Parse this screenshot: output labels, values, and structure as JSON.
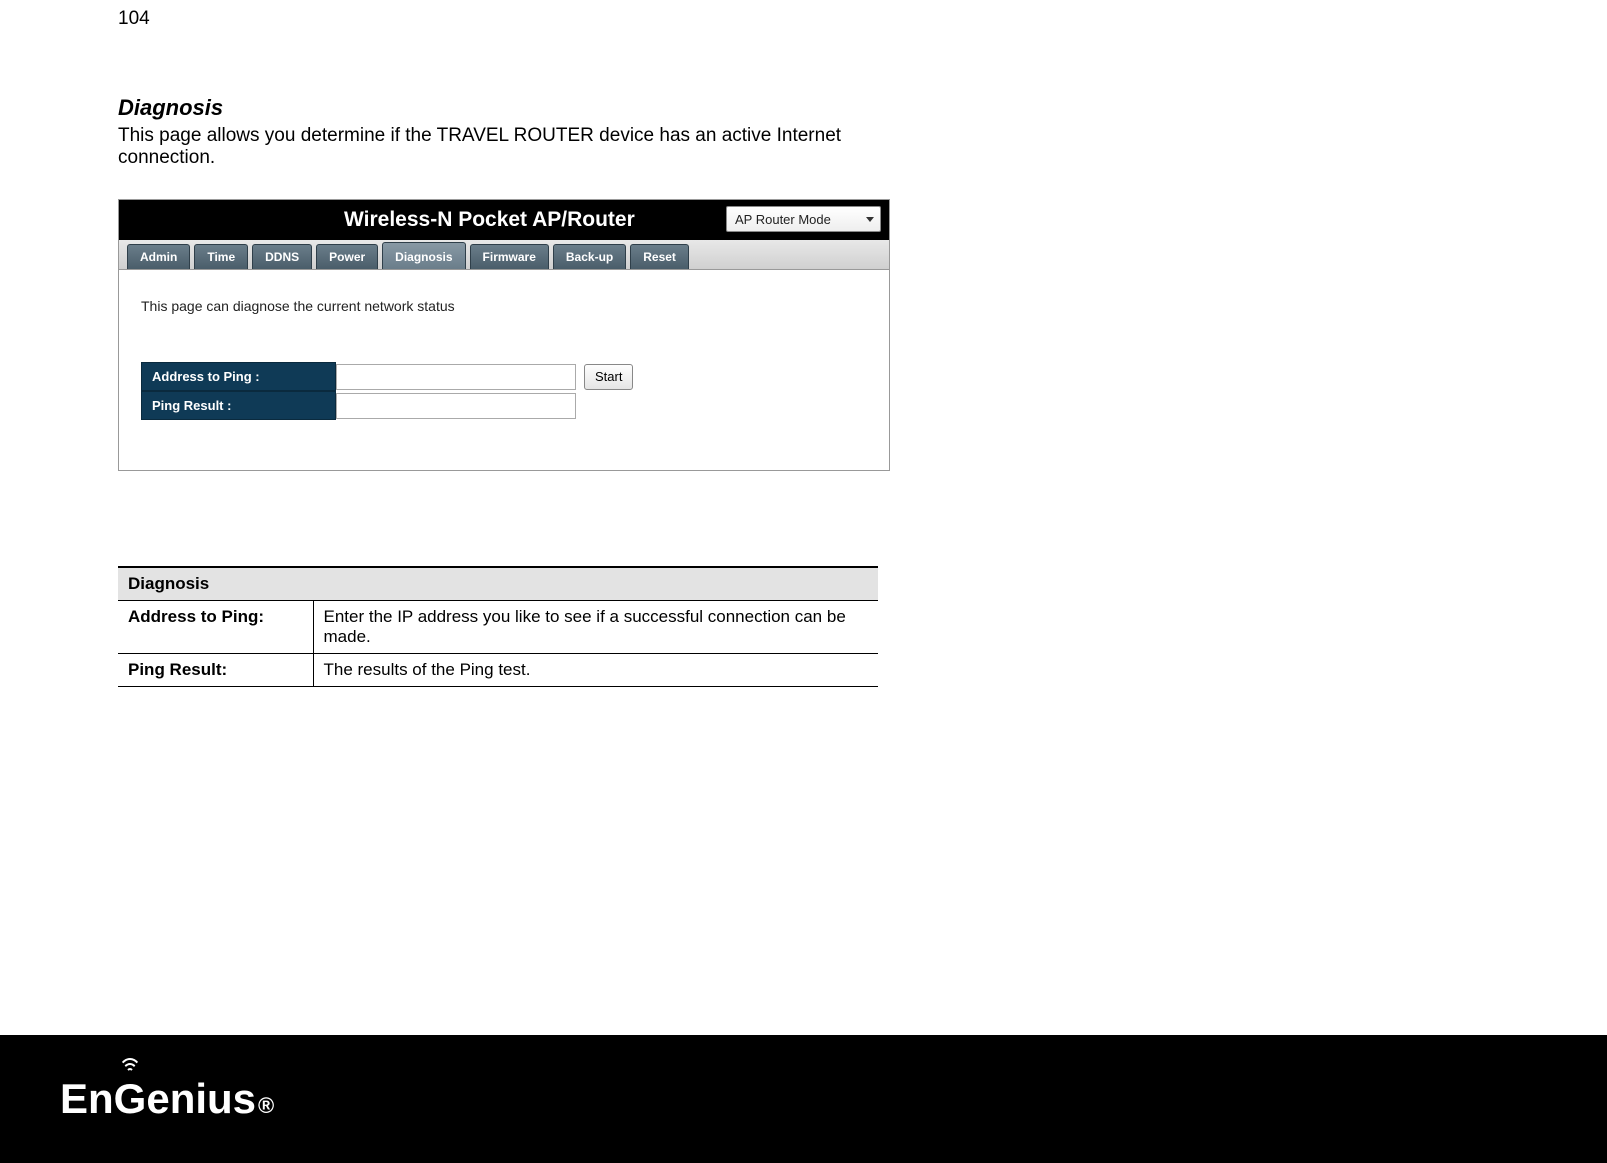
{
  "page_number": "104",
  "section": {
    "title": "Diagnosis",
    "description": "This page allows you determine if the TRAVEL ROUTER device has an active Internet connection."
  },
  "router": {
    "title": "Wireless-N Pocket AP/Router",
    "mode_selected": "AP Router Mode",
    "tabs": [
      "Admin",
      "Time",
      "DDNS",
      "Power",
      "Diagnosis",
      "Firmware",
      "Back-up",
      "Reset"
    ],
    "active_tab": "Diagnosis",
    "note": "This page can diagnose the current network status",
    "rows": {
      "address_label": "Address to Ping :",
      "address_value": "",
      "result_label": "Ping Result :",
      "result_value": ""
    },
    "start_label": "Start"
  },
  "def_table": {
    "header": "Diagnosis",
    "rows": [
      {
        "k": "Address to Ping:",
        "v": "Enter the IP address you like to see if a successful connection can be made."
      },
      {
        "k": "Ping Result:",
        "v": "The results of the Ping test."
      }
    ]
  },
  "brand": "EnGenius",
  "reg_mark": "®"
}
